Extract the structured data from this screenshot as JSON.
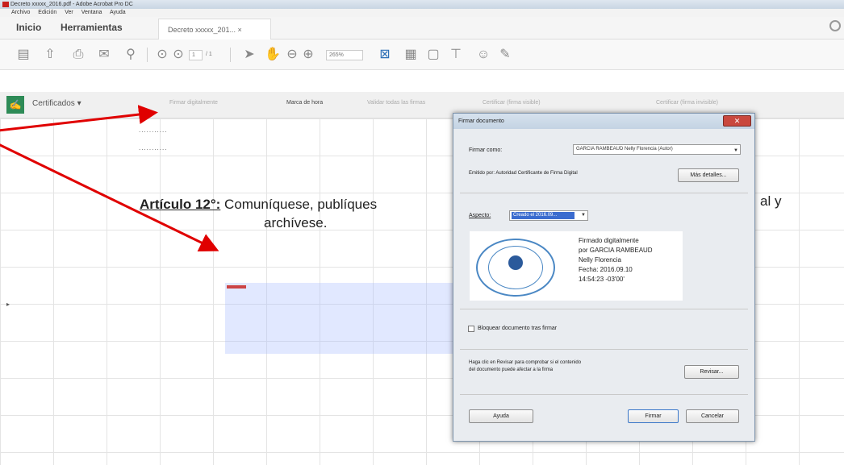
{
  "window": {
    "title": "Decreto xxxxx_2016.pdf - Adobe Acrobat Pro DC"
  },
  "menubar": {
    "items": [
      "Archivo",
      "Edición",
      "Ver",
      "Ventana",
      "Ayuda"
    ]
  },
  "nav": {
    "home": "Inicio",
    "tools": "Herramientas",
    "doc_tab": "Decreto xxxxx_201... ×"
  },
  "toolbar": {
    "page_current": "1",
    "page_total": "/ 1",
    "zoom": "265%"
  },
  "certbar": {
    "label": "Certificados ▾",
    "items": [
      "Firmar digitalmente",
      "Marca de hora",
      "Validar todas las firmas",
      "Certificar (firma visible)",
      "Certificar (firma invisible)"
    ]
  },
  "document": {
    "dots_1": "...........",
    "dots_2": "...........",
    "article_heading": "Artículo 12°:",
    "article_text": " Comuníquese, publíques",
    "article_tail": "al y",
    "article_cont": "archívese."
  },
  "dialog": {
    "title": "Firmar documento",
    "close_label": "✕",
    "sign_as_label": "Firmar como:",
    "signer_value": "GARCIA RAMBEAUD Nelly Florencia (Autor)",
    "issued_by": "Emitido por: Autoridad Certificante de Firma Digital",
    "details_btn": "Más detalles...",
    "aspect_label": "Aspecto:",
    "aspect_value": "Creado el 2016.09...",
    "sig_preview": [
      "Firmado digitalmente",
      "por GARCIA RAMBEAUD",
      "Nelly Florencia",
      "Fecha: 2016.09.10",
      "14:54:23 -03'00'"
    ],
    "lock_label": "Bloquear documento tras firmar",
    "review_text_1": "Haga clic en Revisar para comprobar si el contenido",
    "review_text_2": "del documento puede afectar a la firma",
    "review_btn": "Revisar...",
    "help_btn": "Ayuda",
    "sign_btn": "Firmar",
    "cancel_btn": "Cancelar"
  },
  "colors": {
    "arrow": "#e00000",
    "selection": "#3b6ccf",
    "cert_green": "#2e8b57"
  }
}
